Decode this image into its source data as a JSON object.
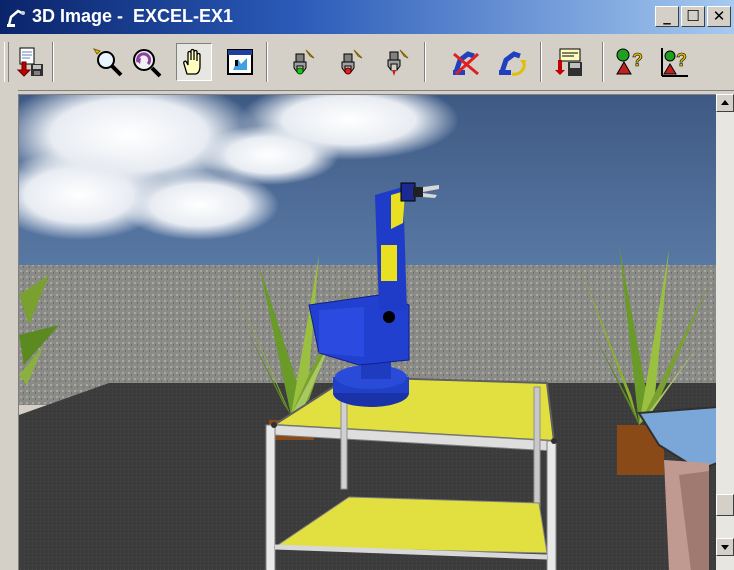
{
  "window": {
    "title": "3D Image -  EXCEL-EX1",
    "minimize_glyph": "_",
    "maximize_glyph": "☐",
    "close_glyph": "✕"
  },
  "toolbar": {
    "buttons": [
      {
        "name": "save-image-button",
        "icon": "page-arrow-disk-icon"
      },
      {
        "name": "zoom-button",
        "icon": "magnifier-icon"
      },
      {
        "name": "rotate-view-button",
        "icon": "magnifier-rotate-icon"
      },
      {
        "name": "pan-hand-button",
        "icon": "hand-icon",
        "pressed": true
      },
      {
        "name": "fit-view-button",
        "icon": "fit-window-icon"
      },
      {
        "name": "gripper-green-button",
        "icon": "gripper-green-icon"
      },
      {
        "name": "gripper-red-button",
        "icon": "gripper-red-icon"
      },
      {
        "name": "gripper-down-button",
        "icon": "gripper-down-icon"
      },
      {
        "name": "robot-cancel-button",
        "icon": "robot-cancel-icon"
      },
      {
        "name": "robot-cycle-button",
        "icon": "robot-cycle-icon"
      },
      {
        "name": "export-button",
        "icon": "export-disk-icon"
      },
      {
        "name": "query-shapes-button",
        "icon": "shapes-question-icon"
      },
      {
        "name": "query-chart-button",
        "icon": "chart-question-icon"
      }
    ]
  },
  "colors": {
    "title_gradient_start": "#0a246a",
    "title_gradient_end": "#a6caf0",
    "robot_blue": "#1f3fcf",
    "robot_yellow": "#e8e020",
    "table_top": "#e2e040",
    "sky": "#4c6a94",
    "floor": "#3e3e3e"
  }
}
